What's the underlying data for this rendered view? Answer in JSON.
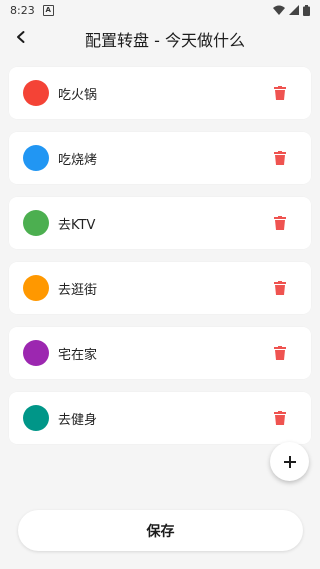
{
  "status_bar": {
    "time": "8:23",
    "notification_letter": "A",
    "icons": [
      "wifi-icon",
      "signal-icon",
      "battery-icon"
    ]
  },
  "app_bar": {
    "back_icon": "chevron-left-icon",
    "title": "配置转盘 - 今天做什么"
  },
  "items": [
    {
      "label": "吃火锅",
      "color": "#F44336"
    },
    {
      "label": "吃烧烤",
      "color": "#2196F3"
    },
    {
      "label": "去KTV",
      "color": "#4CAF50"
    },
    {
      "label": "去逛街",
      "color": "#FF9800"
    },
    {
      "label": "宅在家",
      "color": "#9C27B0"
    },
    {
      "label": "去健身",
      "color": "#009688"
    }
  ],
  "delete_icon": "trash-icon",
  "delete_color": "#EF5350",
  "fab": {
    "icon": "plus-icon"
  },
  "footer": {
    "save_label": "保存"
  }
}
